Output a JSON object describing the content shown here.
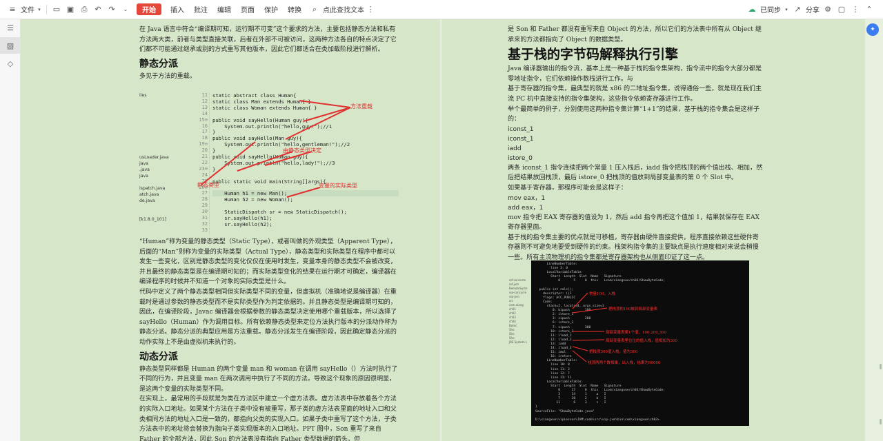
{
  "toolbar": {
    "file_label": "文件",
    "start_label": "开始",
    "menu": [
      "插入",
      "批注",
      "编辑",
      "页面",
      "保护",
      "转换"
    ],
    "search_placeholder": "点此查找文本",
    "sync_label": "已同步",
    "share_label": "分享"
  },
  "left_page": {
    "intro": "在 Java 语言中符合“编译期可知，运行期不可变”这个要求的方法，主要包括静态方法和私有方法两大类，前者与类型直接关联，后者在外部不可被访问，这两种方法各自的特点决定了它们都不可能通过继承或别的方式重写其他版本，因此它们都适合在类加载阶段进行解析。",
    "h_static": "静态分派",
    "static_sub": "多见于方法的重载。",
    "figure1": {
      "files": [
        "iles",
        "",
        "",
        "",
        "",
        "",
        "",
        "",
        "",
        "",
        "usLoader.java",
        "java",
        ".java",
        "java",
        "",
        "ispatch.java",
        "atch.java",
        "de.java",
        "",
        "",
        "[k1.8.0_101]"
      ],
      "gutter": [
        "11",
        "12",
        "13",
        "14",
        "15⊖",
        "16",
        "17",
        "18",
        "19⊖",
        "20",
        "21",
        "22",
        "23⊖",
        "24",
        "25",
        "26⊖",
        "27",
        "28",
        "29",
        "30",
        "31",
        "32",
        "33"
      ],
      "code": [
        "static abstract class Human{",
        "static class Man extends Human{ }",
        "static class Woman extends Human{ }",
        "",
        "public void sayHello(Human guy){",
        "    System.out.println(\"hello,guy!\");//1",
        "}",
        "public void sayHello(Man guy){",
        "    System.out.println(\"hello,gentleman!\");//2",
        "}",
        "public void sayHello(Woman guy){",
        "    System.out.println(\"hello,lady!\");//3",
        "}",
        "",
        "public static void main(String[]args){",
        "",
        "    Human h1 = new Man();",
        "    Human h2 = new Woman();",
        "",
        "    StaticDispatch sr = new StaticDispatch();",
        "    sr.sayHello(h1);",
        "    sr.sayHello(h2);",
        ""
      ],
      "annotations": {
        "overload": "方法重载",
        "static_decide": "由静态类型决定",
        "static_type": "静态类型",
        "actual_type": "变量的实际类型"
      }
    },
    "p1": "“Human”称为变量的静态类型（Static Type），或者叫做的外观类型（Apparent Type），后面的“Man”则称为变量的实际类型（Actual Type），静态类型和实际类型在程序中都可以发生一些变化，区别是静态类型的变化仅仅在使用时发生，变量本身的静态类型不会被改变，并且最终的静态类型是在编译期可知的；而实际类型变化的结果在运行期才可确定，编译器在编译程序的时候并不知道一个对象的实际类型是什么。",
    "p2": "代码中定义了两个静态类型相同但实际类型不同的变量，但虚拟机（准确地说是编译器）在重载时是通过参数的静态类型而不是实际类型作为判定依据的。并且静态类型是编译期可知的，因此，在编译阶段，Javac 编译器会根据参数的静态类型决定使用哪个重载版本，所以选择了 sayHello（Human）作为调用目标。所有依赖静态类型来定位方法执行版本的分派动作称为静态分派。静态分派的典型应用是方法重载。静态分派发生在编译阶段，因此确定静态分派的动作实际上不是由虚拟机来执行的。",
    "h_dynamic": "动态分派",
    "p3": "静态类型同样都是 Human 的两个变量 man 和 woman 在调用 sayHello（）方法时执行了不同的行为，并且变量 man 在两次调用中执行了不同的方法。导致这个现象的原因很明显，是这两个变量的实际类型不同。",
    "p4": "在实现上，最常用的手段就是为类在方法区中建立一个虚方法表。虚方法表中存放着各个方法的实际入口地址。如果某个方法在子类中没有被重写，那子类的虚方法表里面的地址入口和父类相同方法的地址入口是一致的，都指向父类的实现入口。如果子类中重写了这个方法，子类方法表中的地址将会替换为指向子类实现版本的入口地址。PPT 图中，Son 重写了来自 Father 的全部方法，因此 Son 的方法表没有指向 Father 类型数据的箭头。但"
  },
  "right_page": {
    "cont": "是 Son 和 Father 都没有重写来自 Object 的方法，所以它们的方法表中所有从 Object 继承来的方法都指向了 Object 的数据类型。",
    "h1": "基于栈的字节码解释执行引擎",
    "p1": "Java 编译器输出的指令流，基本上是一种基于栈的指令集架构，指令流中的指令大部分都是零地址指令，它们依赖操作数栈进行工作。与",
    "p2": "基于寄存器的指令集，最典型的就是 x86 的二地址指令集，说得通俗一些，就是现在我们主流 PC 机中直接支持的指令集架构，这些指令依赖寄存器进行工作。",
    "p3": "举个最简单的例子，分别使用这两种指令集计算“1+1”的结果，基于栈的指令集会是这样子的：",
    "stack_code": [
      "iconst_1",
      "iconst_1",
      "iadd",
      "istore_0"
    ],
    "p4": "两条 iconst_1 指令连续把两个常量 1 压入栈后，iadd 指令把栈顶的两个值出栈、相加，然后把结果放回栈顶，最后 istore_0 把栈顶的值放到局部变量表的第 0 个 Slot 中。",
    "p5": "如果基于寄存器，那程序可能会是这样子：",
    "reg_code": [
      "mov eax，1",
      "add eax，1"
    ],
    "p6": "mov 指令把 EAX 寄存器的值设为 1，然后 add 指令再把这个值加 1，结果就保存在 EAX 寄存器里面。",
    "p7": "基于栈的指令集主要的优点就是可移植，寄存器由硬件直接提供，程序直接依赖这些硬件寄存器则不可避免地要受到硬件的约束。栈架构指令集的主要缺点是执行速度相对来说会稍慢一些。所有主流物理机的指令集都是寄存器架构也从侧面印证了这一点。",
    "figure2": {
      "side": [
        "ref-concurre",
        "ref-jvm",
        "RemoteSyste",
        "vip-concurre",
        "vip-jvm",
        "src",
        "com.xiang",
        "ch01",
        "ch02",
        "ch03",
        "ch04",
        "Bytec",
        "Sho",
        "Sho",
        "Sho",
        "JRE System L"
      ],
      "lines": [
        "      LineNumberTable:",
        "        line 3: 0",
        "      LocalVariableTable:",
        "        Start  Length  Slot  Name   Signature",
        "            0       5     0  this   Lcom/xiangxue/ch03/ShowByteCode;",
        "",
        "  public int calc();",
        "    descriptor: ()I",
        "    flags: ACC_PUBLIC",
        "    Code:",
        "      stack=2, locals=4, args_size=1",
        "         0: bipush        100",
        "         2: istore_1",
        "         3: sipush        200",
        "         6: istore_2",
        "         7: sipush        300",
        "        10: istore_3",
        "        11: iload_1",
        "        12: iload_2",
        "        13: iadd",
        "        14: iload_3",
        "        15: imul",
        "        16: ireturn",
        "      LineNumberTable:",
        "        line 10: 0",
        "        line 11: 3",
        "        line 12: 7",
        "        line 13: 11",
        "      LocalVariableTable:",
        "        Start  Length  Slot  Name   Signature",
        "            0      17     0  this   Lcom/xiangxue/ch03/ShowByteCode;",
        "            3      14     1     a   I",
        "            7      10     2     b   I",
        "           11       6     3     c   I",
        "}",
        "SourceFile: \"ShowByteCode.java\"",
        "",
        "D:\\xiangxue\\vipLesson\\JVM\\code\\src\\vip-jvm\\bin\\com\\xiangxue\\ch03>"
      ],
      "notes": [
        "常量100，入栈",
        "把栈顶的100放到局部变量表",
        "局部变量表里1个值，100,200,300",
        "局部变量表里位位的值入栈，值相加为300",
        "把栈顶300值入栈，值为300",
        "栈顶两两个数相乘，出入栈，结果为90000"
      ]
    }
  }
}
